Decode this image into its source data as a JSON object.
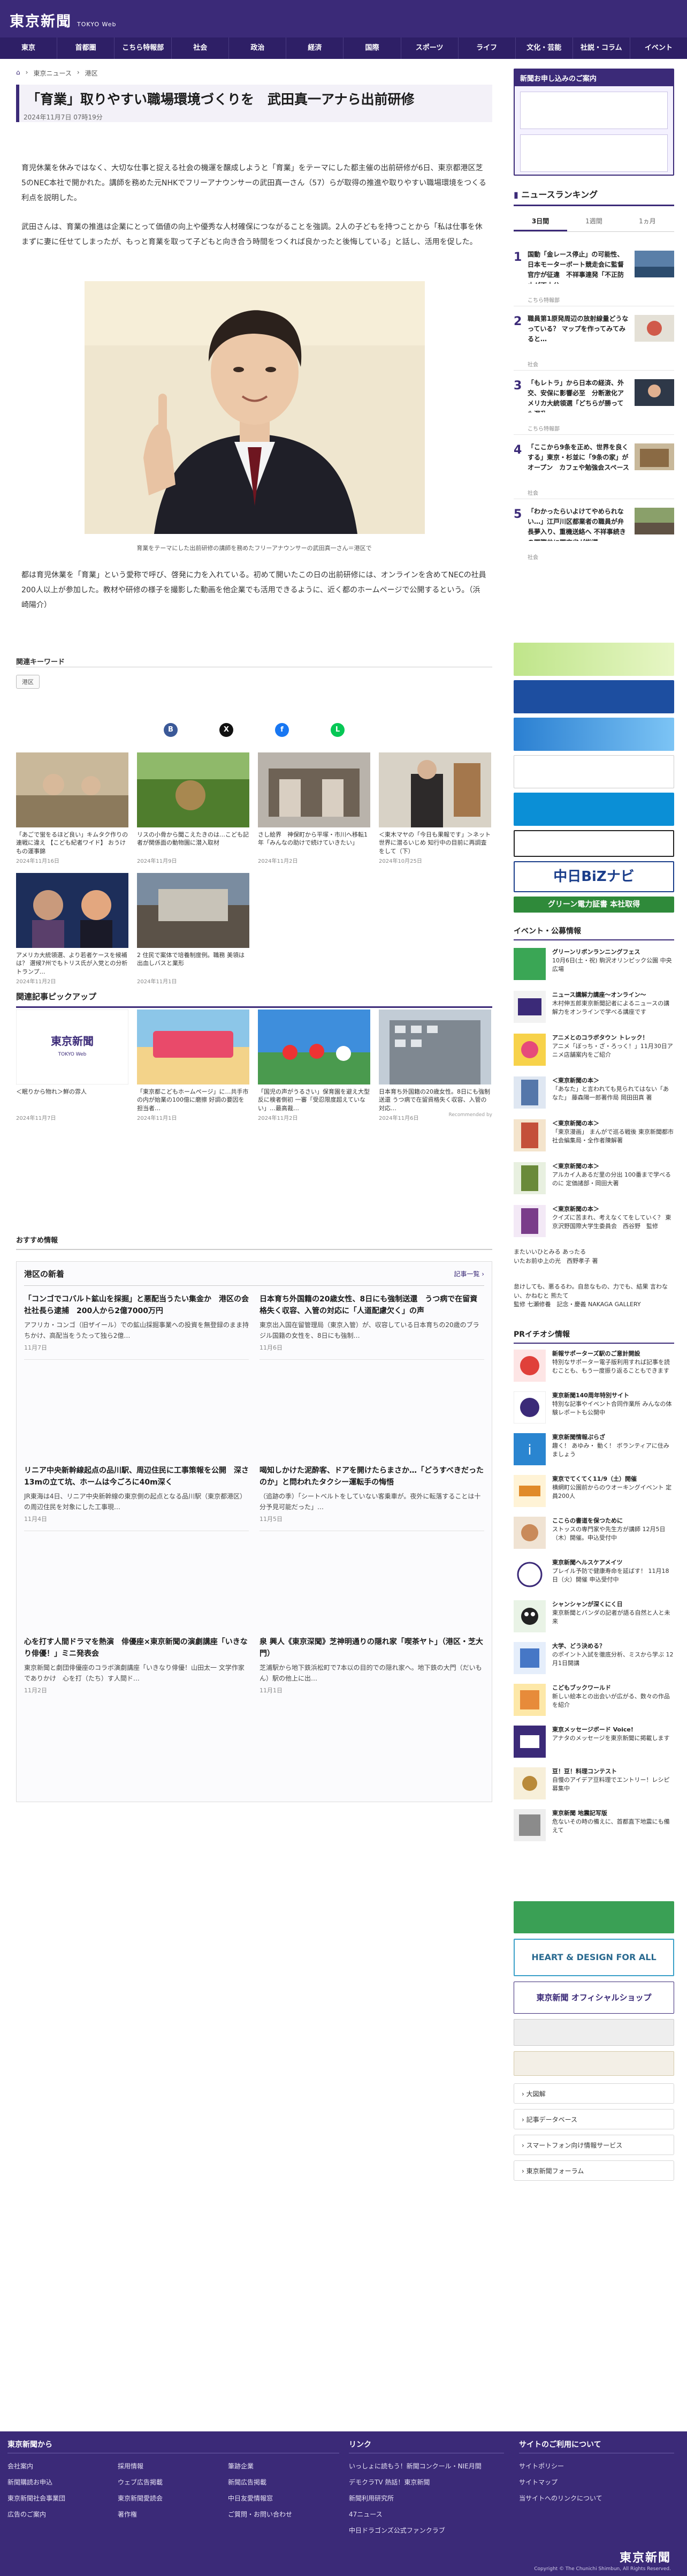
{
  "header": {
    "logo_jp": "東京新聞",
    "logo_en": "TOKYO Web"
  },
  "nav": [
    "東京",
    "首都圏",
    "こちら特報部",
    "社会",
    "政治",
    "経済",
    "国際",
    "スポーツ",
    "ライフ",
    "文化・芸能",
    "社説・コラム",
    "イベント"
  ],
  "breadcrumb": [
    "東京ニュース",
    "港区"
  ],
  "article": {
    "title": "「育業」取りやすい職場環境づくりを　武田真一アナら出前研修",
    "date": "2024年11月7日 07時19分",
    "paragraphs": [
      "育児休業を休みではなく、大切な仕事と捉える社会の機運を醸成しようと「育業」をテーマにした都主催の出前研修が6日、東京都港区芝5のNEC本社で開かれた。講師を務めた元NHKでフリーアナウンサーの武田真一さん（57）らが取得の推進や取りやすい職場環境をつくる利点を説明した。",
      "武田さんは、育業の推進は企業にとって価値の向上や優秀な人材確保につながることを強調。2人の子どもを持つことから「私は仕事を休まずに妻に任せてしまったが、もっと育業を取って子どもと向き合う時間をつくれば良かったと後悔している」と話し、活用を促した。",
      "都は育児休業を「育業」という愛称で呼び、啓発に力を入れている。初めて開いたこの日の出前研修には、オンラインを含めてNECの社員200人以上が参加した。教材や研修の様子を撮影した動画を他企業でも活用できるように、近く都のホームページで公開するという。（浜崎陽介）"
    ],
    "caption": "育業をテーマにした出前研修の講師を務めたフリーアナウンサーの武田真一さん＝港区で"
  },
  "keywords": {
    "heading": "関連キーワード",
    "tag": "港区"
  },
  "related": [
    {
      "title": "「あごで蛍をるほど良い」キムタク作りの連戦に違え 【こども紀者ワイド】 おうけもの運事錦",
      "date": "2024年11月16日"
    },
    {
      "title": "リスの小骨から聞こえたきのは…こども記者が関係面の動物園に潜入取材",
      "date": "2024年11月9日"
    },
    {
      "title": "さし絵界　神保町から平塚・市川へ移転1年「みんなの助けで続けていきたい」",
      "date": "2024年11月2日"
    },
    {
      "title": "＜東木マヤの「今日も果報です」＞ネット世界に潜るいじめ 知行中の目前に再調査をして（下）",
      "date": "2024年10月25日"
    },
    {
      "title": "アメリカ大統領選、より若者ケースを候補は？ 選候7州でもトリス氏が入党との分析 トランプ…",
      "date": "2024年11月2日"
    },
    {
      "title": "2 住民で案体で培養制度例。職務 美領は出血しバスと業形",
      "date": "2024年11月1日"
    }
  ],
  "pickup": {
    "heading": "関連記事ピックアップ",
    "items": [
      {
        "title": "＜眠りから物れ＞鮮の雰人",
        "date": "2024年11月7日"
      },
      {
        "title": "「東京都こどもホームページ」に…共手市の内が始業の100億に磨擦 好調の要因を担当者…",
        "date": "2024年11月1日"
      },
      {
        "title": "「国児の声がうるさい」保育園を避え大型反に検者側初 一審「受忍限度超えていない」…最高裁…",
        "date": "2024年11月2日"
      },
      {
        "title": "日本育ち外国籍の20歳女性。8日にも強制送還 うつ病で在留資格失く収容、入管の対応…",
        "date": "2024年11月6日"
      }
    ],
    "recommended": "Recommended by"
  },
  "recommended_heading": "おすすめ情報",
  "area_news": {
    "title": "港区の新着",
    "more": "記事一覧",
    "items": [
      {
        "title": "「コンゴでコバルト鉱山を採掘」と悪配当うたい集金か　港区の会社社長ら逮捕　200人から2億7000万円",
        "snippet": "アフリカ・コンゴ（旧ザイール）での鉱山採掘事業への投資を無登録のまま持ちかけ、高配当をうたって独ら2億…",
        "date": "11月7日"
      },
      {
        "title": "日本育ち外国籍の20歳女性、8日にも強制送還　うつ病で在留資格失く収容、入管の対応に「人道配慮欠く」の声",
        "snippet": "東京出入国在留管理局（東京入管）が、収容している日本育ちの20歳のブラジル国籍の女性を、8日にも強制…",
        "date": "11月6日"
      },
      {
        "title": "リニア中央新幹線起点の品川駅、周辺住民に工事策報を公開　深さ13mの立て坑、ホームは今ごろに40m深く",
        "snippet": "JR東海は4日、リニア中央新幹線の東京側の起点となる品川駅（東京都港区）の周辺住民を対象にした工事現…",
        "date": "11月4日"
      },
      {
        "title": "喝知しかけた泥酔客、ドアを開けたらまさか…「どうすべきだったのか」と問われたタクシー運転手の悔悟",
        "snippet": "（追跡の季）「シートベルトをしていない客乗車が。夜外に転落することは十分予見可能だった」…",
        "date": "11月5日"
      },
      {
        "title": "心を打す人間ドラマを熱演　俳優座×東京新聞の演劇講座「いきなり俳優！」ミニ発表会",
        "snippet": "東京新聞と劇団俳優座のコラボ演劇講座「いきなり俳優！山田太一 文学作家でありかけ　心を打（たち）す人間ド…",
        "date": "11月2日"
      },
      {
        "title": "泉 興人《東京深聞》芝神明通りの隠れ家「喫茶ヤト」（港区・芝大門）",
        "snippet": "芝浦駅から地下鉄浜松町で7本以の目的での隠れ家へ。地下鉄の大門（だいもん）駅の他上に出…",
        "date": "11月1日"
      }
    ]
  },
  "sidebar": {
    "subscribe": "新聞お申し込みのご案内",
    "ranking_title": "ニュースランキング",
    "ranking_tabs": [
      "3日間",
      "1週間",
      "1ヵ月"
    ],
    "ranking": [
      {
        "rank": "1",
        "title": "国動「金レース停止」の可能性、日本モーターボート競走会に監督官庁が征違　不祥事連発「不正防止が不十分」",
        "cat": "こちら特報部"
      },
      {
        "rank": "2",
        "title": "職員第1原発周辺の放射線量どうなっている？ マップを作ってみてみると…",
        "cat": "社会"
      },
      {
        "rank": "3",
        "title": "「もレトラ」から日本の経済、外交、安保に影響必至　分断激化アメリカ大統領選「どちらが勝っても混乱」",
        "cat": "こちら特報部"
      },
      {
        "rank": "4",
        "title": "「ここから9条を正め、世界を良くする」東京・杉並に「9条の家」がオープン　カフェや勉強会スペース",
        "cat": "社会"
      },
      {
        "rank": "5",
        "title": "「わかったらいよけてやめられない…」江戸川区都業者の職員が弁長夢入り、重機送絡へ 不祥事続きの国際井に国交省が指導",
        "cat": "社会"
      }
    ],
    "banner_labels": [
      "中日BiZナビ",
      "グリーン電力証書 本社取得"
    ],
    "events_title": "イベント・公募情報",
    "events": [
      {
        "title": "グリーンリボンランニングフェス",
        "text": "10月6日(土・祝) 駒沢オリンピック公園 中央広場"
      },
      {
        "title": "ニュース講解力講座〜オンライン〜",
        "text": "木村伸五郎東京新聞記者によるニュースの講解力をオンラインで学べる講座です"
      },
      {
        "title": "アニメとのコラボタウン トレック！",
        "text": "アニメ「ぼっち・ざ・ろっく！」11月30日アニメ店舗案内をご紹介"
      },
      {
        "title": "＜東京新聞の本＞",
        "text": "「あなた」と言われても見られてはない「あなた」 藤森陽一郎著作局 岡田田真 著"
      },
      {
        "title": "＜東京新聞の本＞",
        "text": "「東京漫画」 まんがで巡る戦後 東京新聞都市社会編集局・全作者陳解著"
      },
      {
        "title": "＜東京新聞の本＞",
        "text": "アルカイ人あるだ里の分出 100番まで学べるのに 定価諸部・岡田大著"
      },
      {
        "title": "＜東京新聞の本＞",
        "text": "クイズに苦まれ、考えなくてをしていく？ 東京沢野国際大学生委員会　西谷野　監修"
      }
    ],
    "other1": "またいいひとみる あったる\nいたお前ゆ上の光　西野孝子 著",
    "other2": "怠けしても、悪るるわ。自怠なもの、力でも、結果 言わない、かねむと 熊たて\n監修 七瀬修養　記念・慶義 NAKAGA GALLERY",
    "pr_title": "PRイチオシ情報",
    "pr": [
      {
        "title": "新報サポーターズ駅のご意計開設",
        "text": "特別なサポーター電子版利用すれば記事を読むことも、もう一度振り返ることもできます"
      },
      {
        "title": "東京新聞140周年特別サイト",
        "text": "特別な記事やイベント合同作業所 みんなの体験レポートも公開中"
      },
      {
        "title": "東京新聞情報ぷらざ",
        "text": "趣く！ あゆみ・ 動く！ ボランティアに住みましょう"
      },
      {
        "title": "東京でてくてく11/9（土）開催",
        "text": "横網町公園前からのウオーキングイベント 定員200人"
      },
      {
        "title": "ここらの書道を保つために",
        "text": "ストッスの専門家や先生方が講師 12月5日（木）開催。申込受付中"
      },
      {
        "title": "東京新聞ヘルスケアメイツ",
        "text": "プレイル予防で健康寿命を延ばす！ 11月18日（火）開催 申込受付中"
      },
      {
        "title": "シャンシャンが深くにく日",
        "text": "東京新聞とバンダの記者が語る自然と人と未来"
      },
      {
        "title": "大学、どう決める？",
        "text": "のポイント入試を徹底分析、ミスから学ぶ 12月1日開講"
      },
      {
        "title": "こどもブックワールド",
        "text": "新しい絵本との出会いが広がる、数々の作品を紹介"
      },
      {
        "title": "東京メッセージボード Voice!",
        "text": "アナタのメッセージを東京新聞に掲載します"
      },
      {
        "title": "豆！豆！料理コンテスト",
        "text": "自慢のアイデア豆料理でエントリー！レシピ募集中"
      },
      {
        "title": "東京新聞 地震記写版",
        "text": "危ないその時の備えに、首都直下地震にも備えて"
      }
    ],
    "hd_banner": "HEART & DESIGN FOR ALL",
    "shop_banner": "東京新聞 オフィシャルショップ",
    "links": [
      "大図解",
      "記事データベース",
      "スマートフォン向け情報サービス",
      "東京新聞フォーラム"
    ]
  },
  "footer": {
    "col1_title": "東京新聞から",
    "col1": [
      "会社案内",
      "新聞購読お申込",
      "東京新聞社会事業団",
      "広告のご案内"
    ],
    "col1b": [
      "採用情報",
      "ウェブ広告掲載",
      "東京新聞愛読会",
      "著作権"
    ],
    "col1c": [
      "筆跡企業",
      "新聞広告掲載",
      "中日友愛情報窓",
      "ご質問・お問い合わせ"
    ],
    "col2_title": "リンク",
    "col2": [
      "いっしょに読もう！新聞コンクール・NIE月間",
      "デモクラTV 熱話！東京新聞",
      "新聞利用研究所",
      "47ニュース",
      "中日ドラゴンズ公式ファンクラブ"
    ],
    "col3_title": "サイトのご利用について",
    "col3": [
      "サイトポリシー",
      "サイトマップ",
      "当サイトへのリンクについて"
    ],
    "logo": "東京新聞",
    "copyright": "Copyright © The Chunichi Shimbun, All Rights Reserved."
  }
}
